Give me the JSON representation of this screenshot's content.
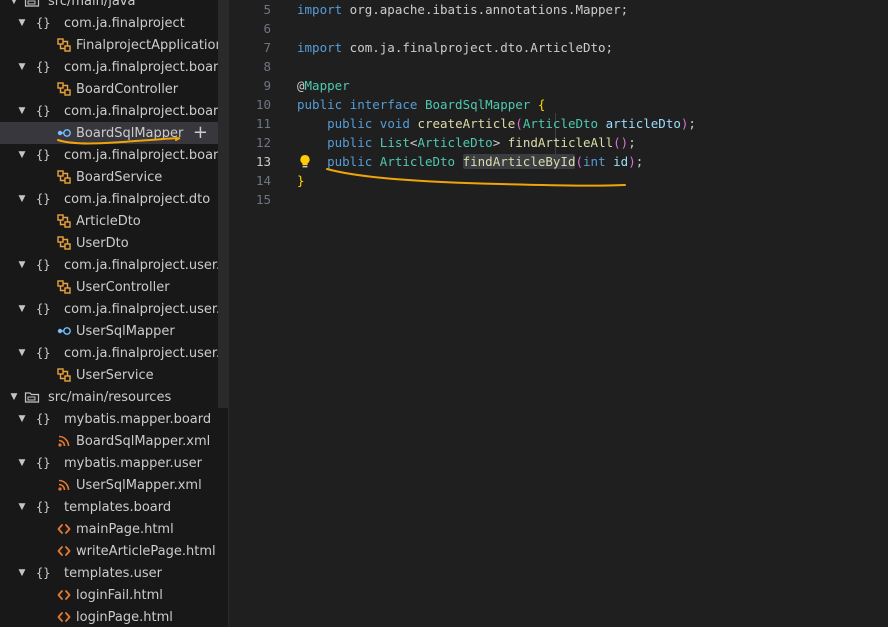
{
  "explorer": {
    "items": [
      {
        "label": "src/main/java",
        "type": "folder",
        "depth": 1,
        "chevron": "down"
      },
      {
        "label": "com.ja.finalproject",
        "type": "package",
        "depth": 2,
        "chevron": "down"
      },
      {
        "label": "FinalprojectApplication",
        "type": "class",
        "depth": 3
      },
      {
        "label": "com.ja.finalproject.boar...",
        "type": "package",
        "depth": 2,
        "chevron": "down"
      },
      {
        "label": "BoardController",
        "type": "class",
        "depth": 3
      },
      {
        "label": "com.ja.finalproject.boar...",
        "type": "package",
        "depth": 2,
        "chevron": "down"
      },
      {
        "label": "BoardSqlMapper",
        "type": "interface",
        "depth": 3,
        "selected": true,
        "plus": "+"
      },
      {
        "label": "com.ja.finalproject.boar...",
        "type": "package",
        "depth": 2,
        "chevron": "down"
      },
      {
        "label": "BoardService",
        "type": "class",
        "depth": 3
      },
      {
        "label": "com.ja.finalproject.dto",
        "type": "package",
        "depth": 2,
        "chevron": "down"
      },
      {
        "label": "ArticleDto",
        "type": "class",
        "depth": 3
      },
      {
        "label": "UserDto",
        "type": "class",
        "depth": 3
      },
      {
        "label": "com.ja.finalproject.user....",
        "type": "package",
        "depth": 2,
        "chevron": "down"
      },
      {
        "label": "UserController",
        "type": "class",
        "depth": 3
      },
      {
        "label": "com.ja.finalproject.user....",
        "type": "package",
        "depth": 2,
        "chevron": "down"
      },
      {
        "label": "UserSqlMapper",
        "type": "interface",
        "depth": 3
      },
      {
        "label": "com.ja.finalproject.user....",
        "type": "package",
        "depth": 2,
        "chevron": "down"
      },
      {
        "label": "UserService",
        "type": "class",
        "depth": 3
      },
      {
        "label": "src/main/resources",
        "type": "folder",
        "depth": 1,
        "chevron": "down"
      },
      {
        "label": "mybatis.mapper.board",
        "type": "package",
        "depth": 2,
        "chevron": "down"
      },
      {
        "label": "BoardSqlMapper.xml",
        "type": "xml",
        "depth": 3
      },
      {
        "label": "mybatis.mapper.user",
        "type": "package",
        "depth": 2,
        "chevron": "down"
      },
      {
        "label": "UserSqlMapper.xml",
        "type": "xml",
        "depth": 3
      },
      {
        "label": "templates.board",
        "type": "package",
        "depth": 2,
        "chevron": "down"
      },
      {
        "label": "mainPage.html",
        "type": "html",
        "depth": 3
      },
      {
        "label": "writeArticlePage.html",
        "type": "html",
        "depth": 3
      },
      {
        "label": "templates.user",
        "type": "package",
        "depth": 2,
        "chevron": "down"
      },
      {
        "label": "loginFail.html",
        "type": "html",
        "depth": 3
      },
      {
        "label": "loginPage.html",
        "type": "html",
        "depth": 3
      }
    ]
  },
  "editor": {
    "active_line": 13,
    "lines": [
      {
        "num": "5",
        "tokens": [
          [
            "kw",
            "import"
          ],
          [
            "pl",
            " org.apache.ibatis.annotations.Mapper;"
          ]
        ]
      },
      {
        "num": "6",
        "tokens": []
      },
      {
        "num": "7",
        "tokens": [
          [
            "kw",
            "import"
          ],
          [
            "pl",
            " com.ja.finalproject.dto.ArticleDto;"
          ]
        ]
      },
      {
        "num": "8",
        "tokens": []
      },
      {
        "num": "9",
        "tokens": [
          [
            "pl",
            "@"
          ],
          [
            "ty",
            "Mapper"
          ]
        ]
      },
      {
        "num": "10",
        "tokens": [
          [
            "kw",
            "public"
          ],
          [
            "pl",
            " "
          ],
          [
            "kw",
            "interface"
          ],
          [
            "pl",
            " "
          ],
          [
            "ty",
            "BoardSqlMapper"
          ],
          [
            "pl",
            " "
          ],
          [
            "br",
            "{"
          ]
        ]
      },
      {
        "num": "11",
        "tokens": [
          [
            "pl",
            "    "
          ],
          [
            "kw",
            "public"
          ],
          [
            "pl",
            " "
          ],
          [
            "kw",
            "void"
          ],
          [
            "pl",
            " "
          ],
          [
            "fn",
            "createArticle"
          ],
          [
            "br2",
            "("
          ],
          [
            "ty",
            "ArticleDto"
          ],
          [
            "pl",
            " "
          ],
          [
            "pa",
            "articleDto"
          ],
          [
            "br2",
            ")"
          ],
          [
            "pl",
            ";"
          ]
        ]
      },
      {
        "num": "12",
        "tokens": [
          [
            "pl",
            "    "
          ],
          [
            "kw",
            "public"
          ],
          [
            "pl",
            " "
          ],
          [
            "ty",
            "List"
          ],
          [
            "pl",
            "<"
          ],
          [
            "ty",
            "ArticleDto"
          ],
          [
            "pl",
            "> "
          ],
          [
            "fn",
            "findArticleAll"
          ],
          [
            "br2",
            "()"
          ],
          [
            "pl",
            ";"
          ]
        ]
      },
      {
        "num": "13",
        "tokens": [
          [
            "pl",
            "    "
          ],
          [
            "kw",
            "public"
          ],
          [
            "pl",
            " "
          ],
          [
            "ty",
            "ArticleDto"
          ],
          [
            "pl",
            " "
          ],
          [
            "fnhl",
            "findArticleById"
          ],
          [
            "br2",
            "("
          ],
          [
            "kw",
            "int"
          ],
          [
            "pl",
            " "
          ],
          [
            "pa",
            "id"
          ],
          [
            "br2",
            ")"
          ],
          [
            "pl",
            ";"
          ]
        ]
      },
      {
        "num": "14",
        "tokens": [
          [
            "br",
            "}"
          ]
        ]
      },
      {
        "num": "15",
        "tokens": []
      }
    ]
  },
  "colors": {
    "annotation_underline": "#f0a30a",
    "lightbulb": "#ffcc00",
    "java_class_icon": "#e8a33d",
    "interface_icon": "#75beff",
    "html_icon": "#e37933",
    "xml_icon": "#e37933"
  }
}
